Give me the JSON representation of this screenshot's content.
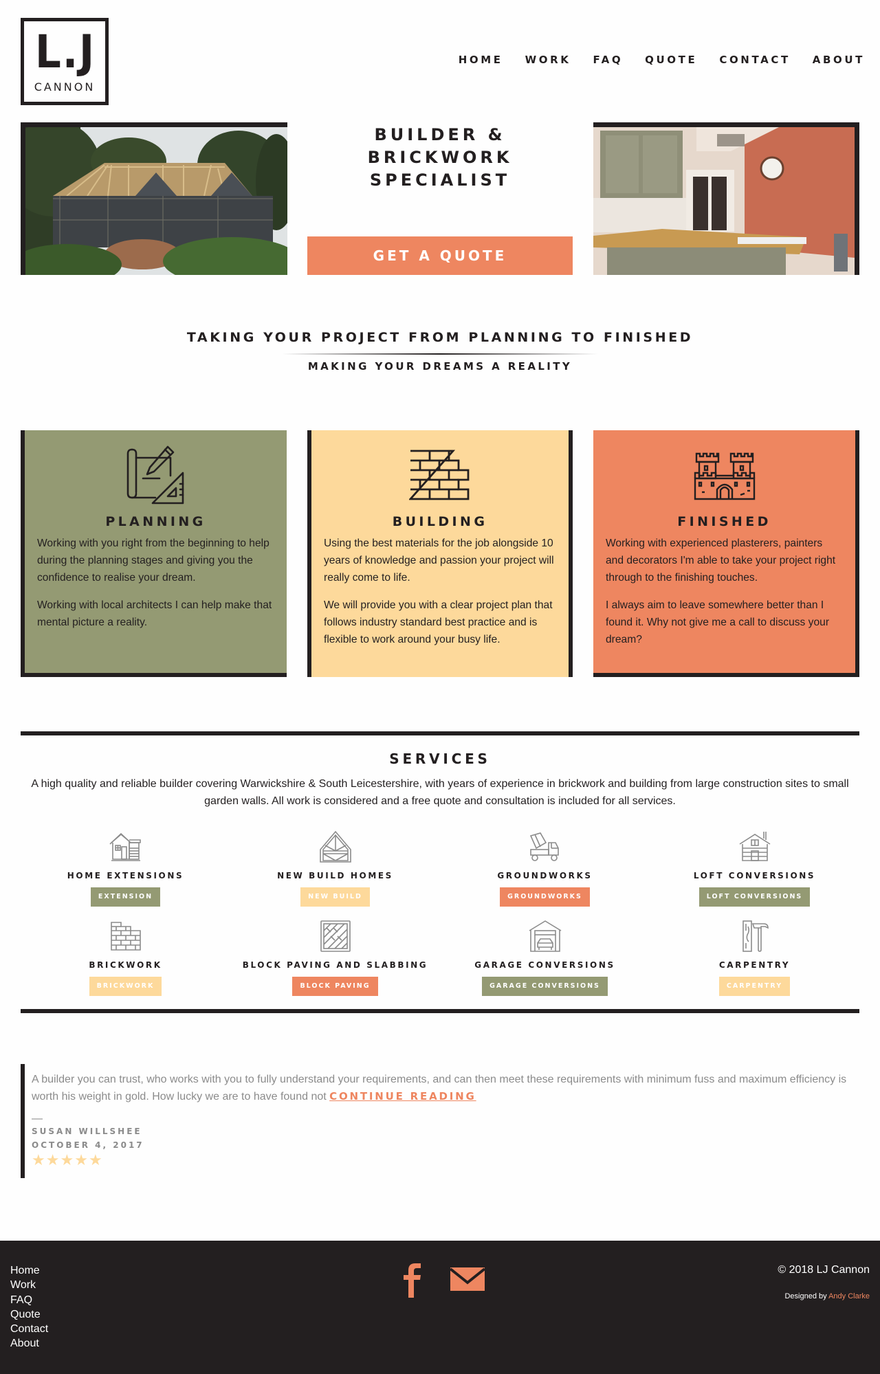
{
  "brand": {
    "logo_mark": "L.J",
    "logo_name": "CANNON"
  },
  "nav": [
    {
      "label": "HOME"
    },
    {
      "label": "WORK"
    },
    {
      "label": "FAQ"
    },
    {
      "label": "QUOTE"
    },
    {
      "label": "CONTACT"
    },
    {
      "label": "ABOUT"
    }
  ],
  "hero": {
    "title": "BUILDER & BRICKWORK SPECIALIST",
    "cta_label": "GET A QUOTE",
    "left_image": "house-under-construction-photo",
    "right_image": "finished-kitchen-photo"
  },
  "tagline": {
    "heading": "TAKING YOUR PROJECT FROM PLANNING TO FINISHED",
    "subheading": "MAKING YOUR DREAMS A REALITY"
  },
  "stages": [
    {
      "icon": "blueprint-pencil-icon",
      "title": "PLANNING",
      "paragraphs": [
        "Working with you right from the beginning to help during the planning stages and giving you the confidence to realise your dream.",
        "Working with local architects I can help make that mental picture a reality."
      ]
    },
    {
      "icon": "brick-wall-icon",
      "title": "BUILDING",
      "paragraphs": [
        "Using the best materials for the job alongside 10 years of knowledge and passion your project will really come to life.",
        "We will provide you with a clear project plan that follows industry standard best practice and is flexible to work around your busy life."
      ]
    },
    {
      "icon": "castle-icon",
      "title": "FINISHED",
      "paragraphs": [
        "Working with experienced plasterers, painters and decorators I'm able to take your project right through to the finishing touches.",
        "I always aim to leave somewhere better than I found it. Why not give me a call to discuss your dream?"
      ]
    }
  ],
  "services": {
    "title": "SERVICES",
    "description": "A high quality and reliable builder covering Warwickshire & South Leicestershire, with years of experience in brickwork and building from large construction sites to small garden walls. All work is considered and a free quote and consultation is included for all services.",
    "items": [
      {
        "icon": "house-extension-icon",
        "name": "HOME EXTENSIONS",
        "tag": "EXTENSION",
        "tag_color": "#949a73"
      },
      {
        "icon": "roof-frame-icon",
        "name": "NEW BUILD HOMES",
        "tag": "NEW BUILD",
        "tag_color": "#fdd99b"
      },
      {
        "icon": "cement-mixer-truck-icon",
        "name": "GROUNDWORKS",
        "tag": "GROUNDWORKS",
        "tag_color": "#ee8660"
      },
      {
        "icon": "log-cabin-icon",
        "name": "LOFT CONVERSIONS",
        "tag": "LOFT CONVERSIONS",
        "tag_color": "#949a73"
      },
      {
        "icon": "brick-wall-icon",
        "name": "BRICKWORK",
        "tag": "BRICKWORK",
        "tag_color": "#fdd99b"
      },
      {
        "icon": "paving-tiles-icon",
        "name": "BLOCK PAVING AND SLABBING",
        "tag": "BLOCK PAVING",
        "tag_color": "#ee8660"
      },
      {
        "icon": "garage-car-icon",
        "name": "GARAGE CONVERSIONS",
        "tag": "GARAGE CONVERSIONS",
        "tag_color": "#949a73"
      },
      {
        "icon": "plank-hammer-icon",
        "name": "CARPENTRY",
        "tag": "CARPENTRY",
        "tag_color": "#fdd99b"
      }
    ]
  },
  "testimonial": {
    "quote": "A builder you can trust, who works with you to fully understand your requirements, and can then meet these requirements with minimum fuss and maximum efficiency is worth his weight in gold. How lucky we are to have found not",
    "continue_label": "CONTINUE READING",
    "dash": "—",
    "author": "SUSAN WILLSHEE",
    "date": "OCTOBER 4, 2017",
    "rating": 5,
    "rating_max": 5
  },
  "footer": {
    "links": [
      {
        "label": "Home"
      },
      {
        "label": "Work"
      },
      {
        "label": "FAQ"
      },
      {
        "label": "Quote"
      },
      {
        "label": "Contact"
      },
      {
        "label": "About"
      }
    ],
    "social": [
      {
        "icon": "facebook-icon"
      },
      {
        "icon": "email-icon"
      }
    ],
    "copyright": "© 2018 LJ Cannon",
    "designed_prefix": "Designed by",
    "designer": "Andy Clarke"
  },
  "colors": {
    "dark": "#231f20",
    "olive": "#949a73",
    "sand": "#fdd99b",
    "coral": "#ee8660",
    "muted_text": "#8b8b8b"
  }
}
